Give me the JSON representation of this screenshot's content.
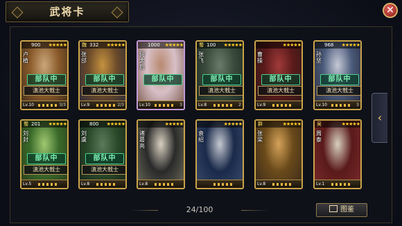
{
  "window": {
    "title": "武将卡",
    "close_label": "✕"
  },
  "pager": {
    "text": "24/100"
  },
  "album_button": {
    "label": "图鉴"
  },
  "side_tab": {
    "label": "‹"
  },
  "deploy_label": "部队中",
  "cards": [
    {
      "name": "卢植",
      "cost": "900",
      "faction": "",
      "level": "Lv.10",
      "count": "3/3",
      "deployed": true,
      "skill": "滇池大戟士",
      "rarity": "gold",
      "colors": [
        "#8a5a2a",
        "#c9a67a",
        "#3a2a1a"
      ]
    },
    {
      "name": "张郃",
      "cost": "332",
      "faction": "魏",
      "level": "Lv.9",
      "count": "2/3",
      "deployed": true,
      "skill": "滇池大戟士",
      "rarity": "gold",
      "colors": [
        "#6b4a2a",
        "#c4923f",
        "#2a2a3a"
      ]
    },
    {
      "name": "何太后",
      "cost": "1000",
      "faction": "",
      "level": "Lv.10",
      "count": "3",
      "deployed": true,
      "skill": "",
      "rarity": "purple",
      "colors": [
        "#d8c0c8",
        "#b88a70",
        "#7a5a4a"
      ]
    },
    {
      "name": "张飞",
      "cost": "100",
      "faction": "蜀",
      "level": "Lv.8",
      "count": "2",
      "deployed": true,
      "skill": "滇池大戟士",
      "rarity": "gold",
      "colors": [
        "#3a4a3a",
        "#6a7a6a",
        "#1a2a24"
      ]
    },
    {
      "name": "曹操",
      "cost": "",
      "faction": "",
      "level": "Lv.9",
      "count": "",
      "deployed": true,
      "skill": "滇池大戟士",
      "rarity": "gold",
      "colors": [
        "#5a1a1a",
        "#a03a3a",
        "#2a1a1a"
      ]
    },
    {
      "name": "孙坚",
      "cost": "968",
      "faction": "",
      "level": "Lv.10",
      "count": "3",
      "deployed": true,
      "skill": "滇池大戟士",
      "rarity": "gold",
      "colors": [
        "#4a5a7a",
        "#c6c9d6",
        "#2a2a3a"
      ]
    },
    {
      "name": "刘封",
      "cost": "201",
      "faction": "蜀",
      "level": "Lv.5",
      "count": "",
      "deployed": true,
      "skill": "滇池大戟士",
      "rarity": "gold",
      "colors": [
        "#3a6a2a",
        "#a0c870",
        "#2a3a1a"
      ]
    },
    {
      "name": "刘虞",
      "cost": "800",
      "faction": "",
      "level": "Lv.8",
      "count": "",
      "deployed": true,
      "skill": "滇池大戟士",
      "rarity": "gold",
      "colors": [
        "#2a4a2a",
        "#5a7a5a",
        "#1a241a"
      ]
    },
    {
      "name": "诸葛亮",
      "cost": "",
      "faction": "",
      "level": "Lv.8",
      "count": "",
      "deployed": false,
      "skill": "",
      "rarity": "gold",
      "colors": [
        "#2a2a2a",
        "#d8d0c0",
        "#6a6a5a"
      ]
    },
    {
      "name": "袁绍",
      "cost": "",
      "faction": "",
      "level": "",
      "count": "",
      "deployed": false,
      "skill": "",
      "rarity": "gold",
      "colors": [
        "#1a2a4a",
        "#c4c8d0",
        "#3a4a6a"
      ]
    },
    {
      "name": "张梁",
      "cost": "",
      "faction": "群",
      "level": "Lv.8",
      "count": "",
      "deployed": false,
      "skill": "",
      "rarity": "gold",
      "colors": [
        "#6a4a1a",
        "#d4a25a",
        "#3a2a1a"
      ]
    },
    {
      "name": "周泰",
      "cost": "",
      "faction": "吴",
      "level": "Lv.1",
      "count": "",
      "deployed": false,
      "skill": "",
      "rarity": "gold",
      "colors": [
        "#5a1a1a",
        "#d8d0c0",
        "#7a2a2a"
      ]
    }
  ],
  "colors": {
    "gold_border": "#caa44a",
    "purple_border": "#c59bd8",
    "deploy_text": "#7df0b4",
    "star": "#ffcc2a"
  }
}
